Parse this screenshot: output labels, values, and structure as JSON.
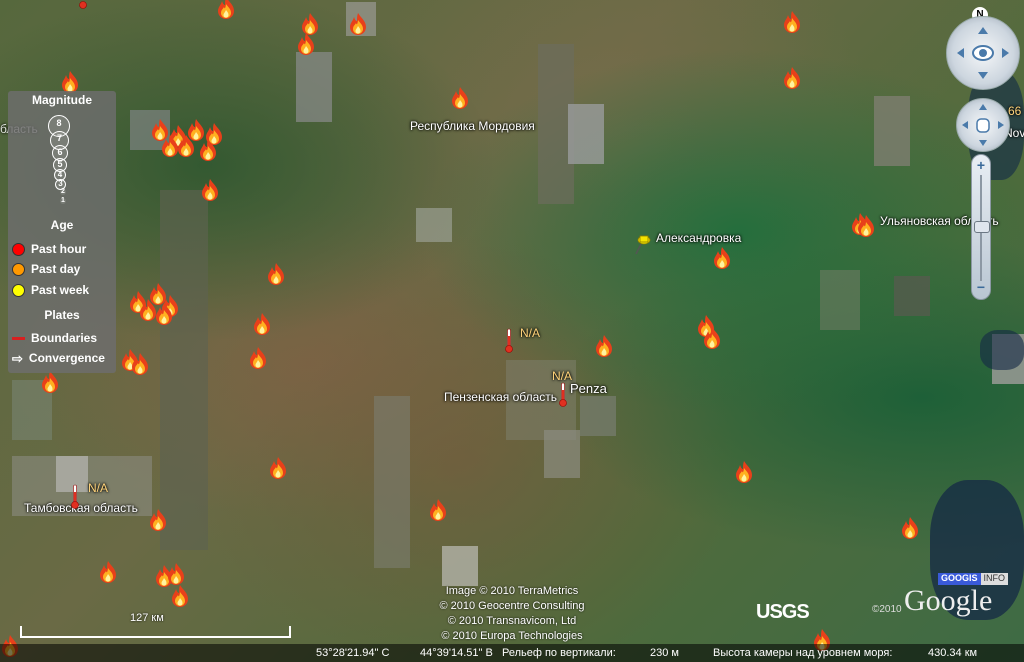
{
  "map": {
    "place_labels": {
      "mordovia": "Республика Мордовия",
      "aleksandrovka": "Александровка",
      "ulyanovsk": "Ульяновская область",
      "penza": "Penza",
      "penza_oblast": "Пензенская область",
      "tambov": "Тамбовская область",
      "na1": "N/A",
      "na2": "N/A",
      "na3": "N/A"
    },
    "edge_fragments": {
      "left_oblast": "бласть",
      "right_66": "66",
      "right_nov": "Nov"
    }
  },
  "legend": {
    "magnitude_title": "Magnitude",
    "magnitudes": [
      "8",
      "7",
      "6",
      "5",
      "4",
      "3",
      "2",
      "1"
    ],
    "age_title": "Age",
    "age_items": [
      {
        "label": "Past hour",
        "color": "#ff0000"
      },
      {
        "label": "Past day",
        "color": "#ff9900"
      },
      {
        "label": "Past week",
        "color": "#ffff00"
      }
    ],
    "plates_title": "Plates",
    "plates_items": [
      {
        "label": "Boundaries",
        "icon": "red-line-icon"
      },
      {
        "label": "Convergence",
        "icon": "white-arrow-icon"
      }
    ]
  },
  "navigation": {
    "north_label": "N",
    "zoom_plus": "+",
    "zoom_minus": "−"
  },
  "credits": {
    "lines": [
      "Image © 2010 TerraMetrics",
      "© 2010 Geocentre Consulting",
      "© 2010 Transnavicom, Ltd",
      "© 2010 Europa Technologies"
    ],
    "usgs": "USGS",
    "year": "©2010",
    "google": "Google",
    "googis": "GOOGIS",
    "info": "INFO"
  },
  "scale": {
    "label": "127 км",
    "fraction": 1
  },
  "status": {
    "lat": "53°28'21.94\" С",
    "lon": "44°39'14.51\" В",
    "elevation_label": "Рельеф по вертикали:",
    "elevation_value": "230 м",
    "camera_label": "Высота камеры над уровнем моря:",
    "camera_value": "430.34 км"
  },
  "colors": {
    "pin": "#f5e400",
    "thermometer": "#e03020",
    "status_bg": "#000000"
  }
}
